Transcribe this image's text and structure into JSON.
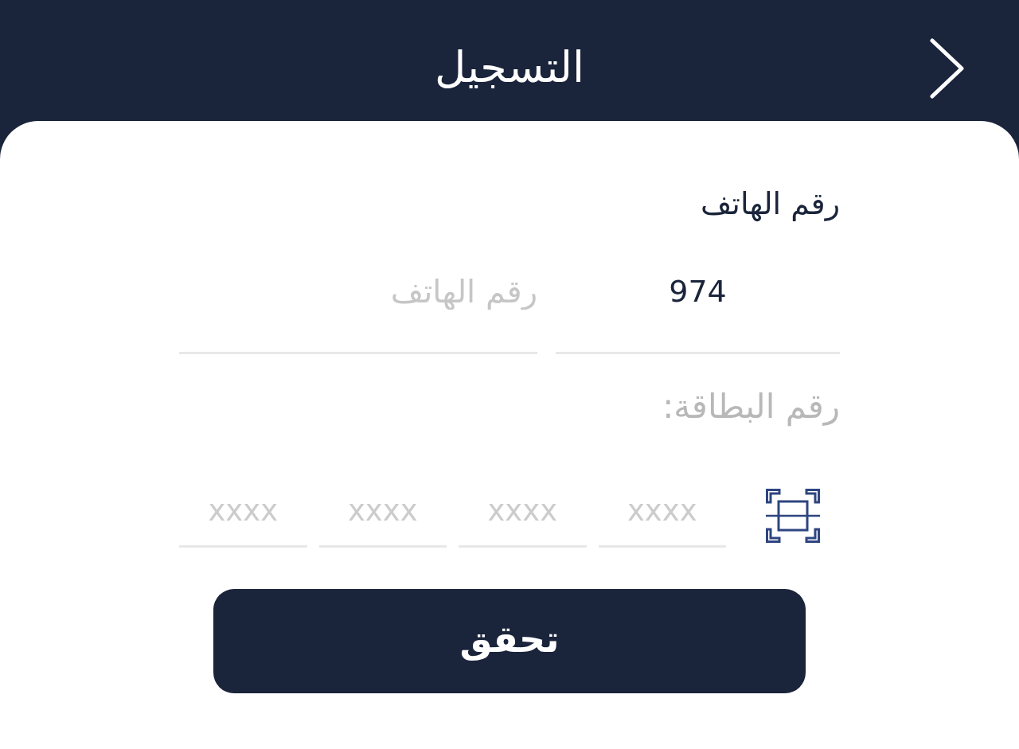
{
  "header": {
    "title": "التسجيل"
  },
  "phone": {
    "label": "رقم الهاتف",
    "country_code": {
      "value": "974"
    },
    "number": {
      "placeholder": "رقم الهاتف"
    }
  },
  "card": {
    "label": "رقم البطاقة:",
    "fields": [
      {
        "placeholder": "xxxx"
      },
      {
        "placeholder": "xxxx"
      },
      {
        "placeholder": "xxxx"
      },
      {
        "placeholder": "xxxx"
      }
    ]
  },
  "button": {
    "label": "تحقق"
  }
}
